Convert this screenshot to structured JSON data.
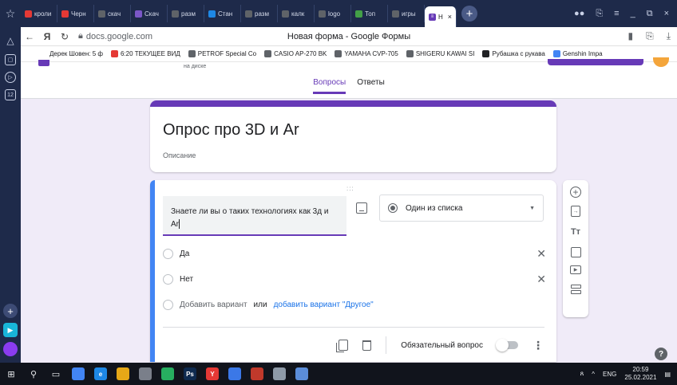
{
  "browser": {
    "tabs": [
      {
        "label": "кроли",
        "color": "#e53935"
      },
      {
        "label": "Черн",
        "color": "#e53935"
      },
      {
        "label": "скач",
        "color": "#5f6368"
      },
      {
        "label": "Скач",
        "color": "#7b57c7"
      },
      {
        "label": "разм",
        "color": "#5f6368"
      },
      {
        "label": "Стан",
        "color": "#1e88e5"
      },
      {
        "label": "разм",
        "color": "#5f6368"
      },
      {
        "label": "калк",
        "color": "#5f6368"
      },
      {
        "label": "logo",
        "color": "#5f6368"
      },
      {
        "label": "Топ",
        "color": "#43a047"
      },
      {
        "label": "игры",
        "color": "#5f6368"
      }
    ],
    "active_tab": {
      "label": "Н",
      "color": "#673ab7"
    },
    "url": "docs.google.com",
    "page_title": "Новая форма - Google Формы",
    "bookmarks": [
      {
        "label": "Дерек Шовен: 5 ф",
        "color": ""
      },
      {
        "label": "6:20 ТЕКУЩЕЕ ВИД",
        "color": "#e53935"
      },
      {
        "label": "PETROF Special Co",
        "color": "#5f6368"
      },
      {
        "label": "CASIO AP-270 BK",
        "color": "#5f6368"
      },
      {
        "label": "YAMAHA CVP-705",
        "color": "#5f6368"
      },
      {
        "label": "SHIGERU KAWAI SI",
        "color": "#5f6368"
      },
      {
        "label": "Рубашка с рукава",
        "color": "#202124"
      },
      {
        "label": "Genshin Impa",
        "color": "#4285f4"
      }
    ]
  },
  "forms_header": {
    "drive_note": "на диске",
    "tabs": [
      {
        "label": "Вопросы",
        "active": true
      },
      {
        "label": "Ответы",
        "active": false
      }
    ]
  },
  "form": {
    "title": "Опрос про 3D и Ar",
    "description": "Описание"
  },
  "question": {
    "drag_handle": ":::",
    "text": "Знаете ли вы о таких технологиях как 3д и Ar",
    "type": "Один из списка",
    "options": [
      "Да",
      "Нет"
    ],
    "add_option": "Добавить вариант",
    "or": "или",
    "add_other": "добавить вариант \"Другое\"",
    "required_label": "Обязательный вопрос",
    "required": false
  },
  "sidebar_tools": [
    "add-question",
    "import-questions",
    "add-title",
    "add-image",
    "add-video",
    "add-section"
  ],
  "taskbar": {
    "language": "ENG",
    "time": "20:59",
    "date": "25.02.2021",
    "apps": [
      {
        "label": "",
        "color": "#4285f4"
      },
      {
        "label": "e",
        "color": "#1e88e5"
      },
      {
        "label": "",
        "color": "#e6a817"
      },
      {
        "label": "",
        "color": "#7a7f8a"
      },
      {
        "label": "",
        "color": "#27ae60"
      },
      {
        "label": "Ps",
        "color": "#0e2a4f"
      },
      {
        "label": "Y",
        "color": "#e53935"
      },
      {
        "label": "",
        "color": "#3b78e7"
      },
      {
        "label": "",
        "color": "#c0392b"
      },
      {
        "label": "",
        "color": "#8e9aa8"
      },
      {
        "label": "",
        "color": "#5b8dd9"
      }
    ]
  }
}
